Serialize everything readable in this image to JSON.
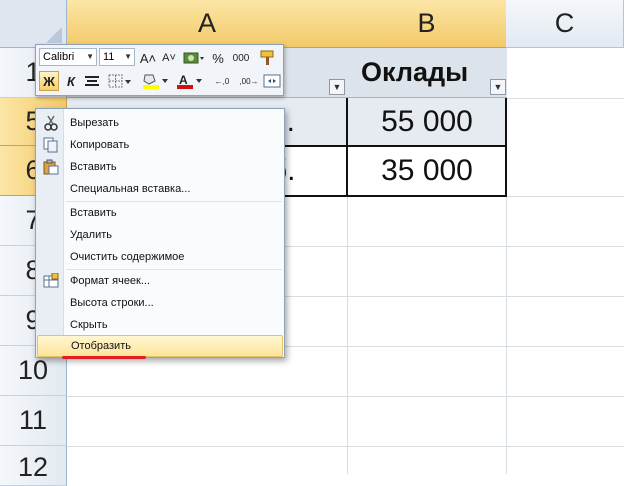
{
  "columns": [
    "A",
    "B",
    "C"
  ],
  "rows": [
    "1",
    "5",
    "6",
    "7",
    "8",
    "9",
    "10",
    "11",
    "12"
  ],
  "header_cell": "Оклады",
  "cells": [
    {
      "a_suffix": "н.",
      "b": "55 000"
    },
    {
      "a_suffix": "б.",
      "b": "35 000"
    }
  ],
  "toolbar": {
    "font": "Calibri",
    "size": "11",
    "grow_font": "A˄",
    "shrink_font": "A˅",
    "percent": "%",
    "thousands": "000",
    "bold": "Ж",
    "italic": "К",
    "font_color_letter": "A",
    "inc_decimal": "←,0",
    "dec_decimal": ",00→"
  },
  "menu": {
    "items": [
      {
        "label": "Вырезать",
        "icon": "scissors-icon"
      },
      {
        "label": "Копировать",
        "icon": "copy-icon"
      },
      {
        "label": "Вставить",
        "icon": "paste-icon"
      },
      {
        "label": "Специальная вставка..."
      },
      {
        "label": "Вставить"
      },
      {
        "label": "Удалить"
      },
      {
        "label": "Очистить содержимое"
      },
      {
        "label": "Формат ячеек...",
        "icon": "format-cells-icon"
      },
      {
        "label": "Высота строки..."
      },
      {
        "label": "Скрыть"
      },
      {
        "label": "Отобразить",
        "highlighted": true
      }
    ]
  },
  "colors": {
    "selected_header": "#f3c969",
    "highlight": "#fde49a",
    "underline": "#e0201e",
    "font_color": "#d01010",
    "fill_color": "#ffff00"
  }
}
